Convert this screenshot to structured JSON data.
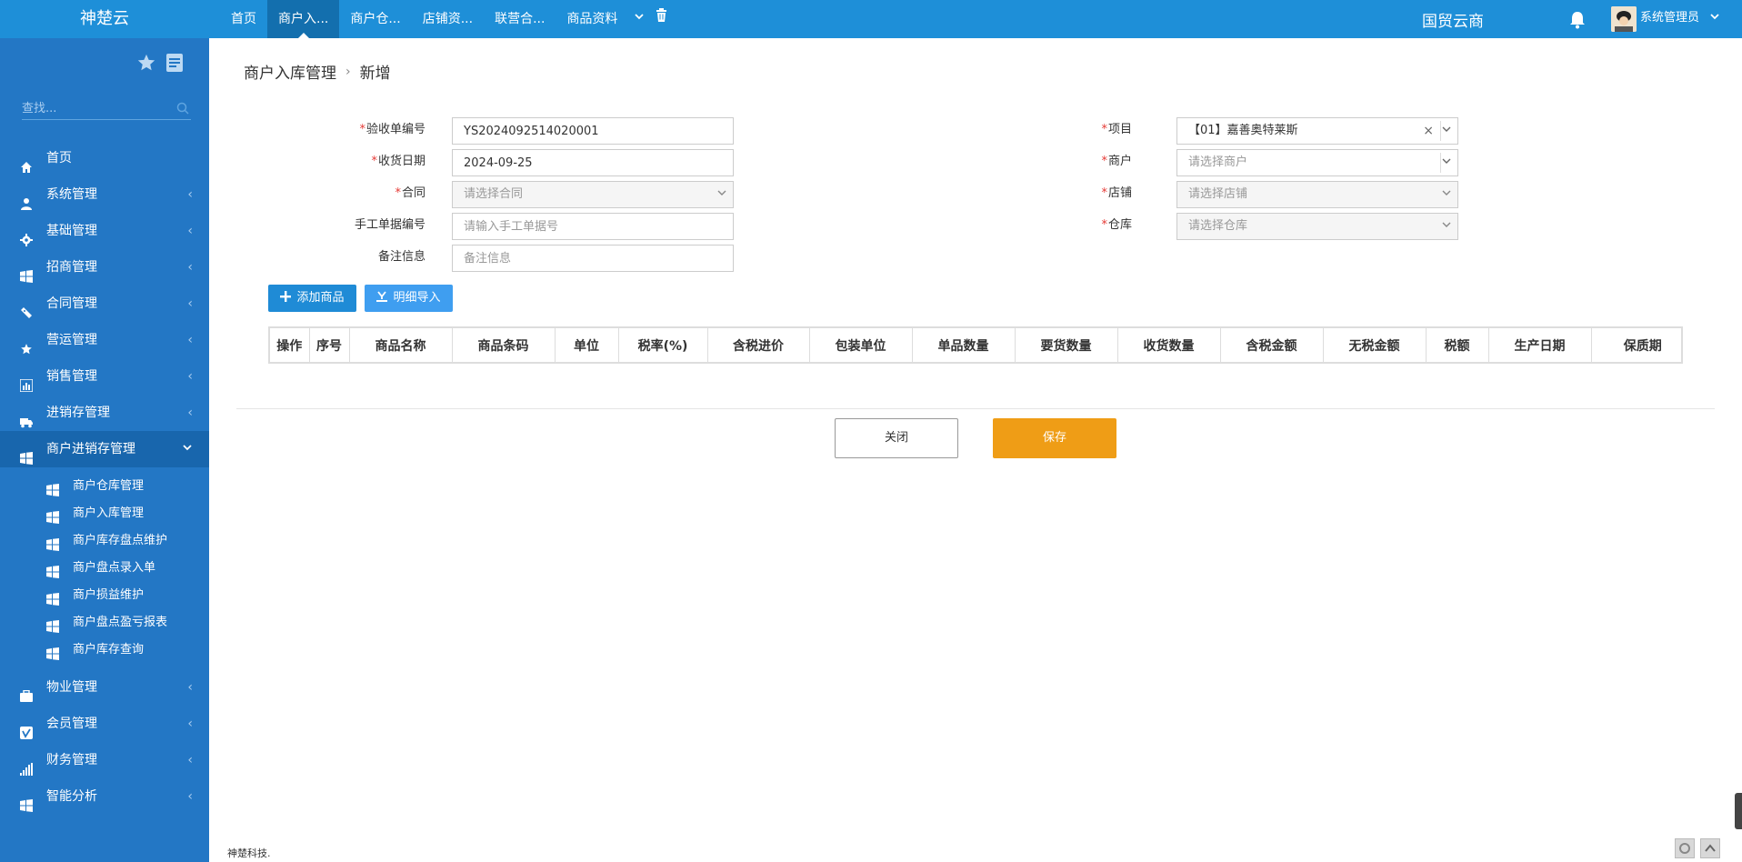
{
  "topbar": {
    "brand": "神楚云",
    "tabs": [
      {
        "label": "首页",
        "active": false
      },
      {
        "label": "商户入...",
        "active": true
      },
      {
        "label": "商户仓...",
        "active": false
      },
      {
        "label": "店铺资...",
        "active": false
      },
      {
        "label": "联营合...",
        "active": false
      },
      {
        "label": "商品资料",
        "active": false
      }
    ],
    "company": "国贸云商",
    "user_name": "系统管理员"
  },
  "sidebar": {
    "search_placeholder": "查找...",
    "menu": [
      {
        "label": "首页",
        "icon": "home-icon"
      },
      {
        "label": "系统管理",
        "icon": "user-icon"
      },
      {
        "label": "基础管理",
        "icon": "gear-icon"
      },
      {
        "label": "招商管理",
        "icon": "windows-icon"
      },
      {
        "label": "合同管理",
        "icon": "ticket-icon"
      },
      {
        "label": "营运管理",
        "icon": "star-icon"
      },
      {
        "label": "销售管理",
        "icon": "bar-chart-icon"
      },
      {
        "label": "进销存管理",
        "icon": "truck-icon"
      },
      {
        "label": "商户进销存管理",
        "icon": "windows-icon",
        "open": true
      }
    ],
    "submenu": [
      {
        "label": "商户仓库管理"
      },
      {
        "label": "商户入库管理"
      },
      {
        "label": "商户库存盘点维护"
      },
      {
        "label": "商户盘点录入单"
      },
      {
        "label": "商户损益维护"
      },
      {
        "label": "商户盘点盈亏报表"
      },
      {
        "label": "商户库存查询"
      }
    ],
    "menu_after": [
      {
        "label": "物业管理",
        "icon": "briefcase-icon"
      },
      {
        "label": "会员管理",
        "icon": "vimeo-icon"
      },
      {
        "label": "财务管理",
        "icon": "signal-icon"
      },
      {
        "label": "智能分析",
        "icon": "windows-icon"
      }
    ]
  },
  "breadcrumb": {
    "parent": "商户入库管理",
    "sep": "›",
    "current": "新增"
  },
  "form": {
    "receipt_no_label": "验收单编号",
    "receipt_no_value": "YS2024092514020001",
    "receive_date_label": "收货日期",
    "receive_date_value": "2024-09-25",
    "contract_label": "合同",
    "contract_placeholder": "请选择合同",
    "manual_no_label": "手工单据编号",
    "manual_no_placeholder": "请输入手工单据号",
    "remark_label": "备注信息",
    "remark_placeholder": "备注信息",
    "project_label": "项目",
    "project_value": "【01】嘉善奥特莱斯",
    "merchant_label": "商户",
    "merchant_placeholder": "请选择商户",
    "shop_label": "店铺",
    "shop_placeholder": "请选择店铺",
    "warehouse_label": "仓库",
    "warehouse_placeholder": "请选择仓库",
    "required_mark": "*"
  },
  "actions": {
    "add_goods": "添加商品",
    "import_detail": "明细导入"
  },
  "grid": {
    "columns": [
      "操作",
      "序号",
      "商品名称",
      "商品条码",
      "单位",
      "税率(%)",
      "含税进价",
      "包装单位",
      "单品数量",
      "要货数量",
      "收货数量",
      "含税金额",
      "无税金额",
      "税额",
      "生产日期",
      "保质期"
    ]
  },
  "footer_buttons": {
    "close": "关闭",
    "save": "保存"
  },
  "footer": {
    "text": "神楚科技."
  },
  "colors": {
    "topbar": "#1e8fd8",
    "sidebar": "#2377c5",
    "primary_button": "#1f8bd6",
    "save_button": "#ef9d16",
    "required": "#e53935"
  }
}
